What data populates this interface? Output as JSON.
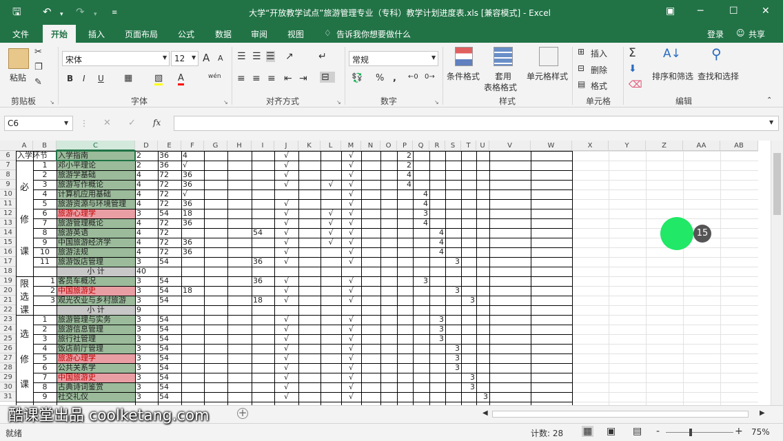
{
  "window": {
    "title": "大学“开放教学试点”旅游管理专业（专科）教学计划进度表.xls  [兼容模式]  -  Excel",
    "login": "登录",
    "share": "共享"
  },
  "icons": {
    "save": "save-icon",
    "undo": "undo-icon",
    "redo": "redo-icon",
    "customize": "customize-quick-access-icon",
    "ribbon_display": "ribbon-display-icon",
    "minimize": "minimize-icon",
    "restore": "restore-icon",
    "close": "close-icon",
    "share": "share-icon",
    "search": "lightbulb-icon"
  },
  "tabs": [
    "文件",
    "开始",
    "插入",
    "页面布局",
    "公式",
    "数据",
    "审阅",
    "视图"
  ],
  "tellme": "告诉我你想要做什么",
  "ribbon": {
    "clipboard": {
      "paste": "粘贴",
      "label": "剪贴板"
    },
    "font": {
      "name": "宋体",
      "size": "12",
      "label": "字体",
      "bold": "B",
      "italic": "I",
      "underline": "U",
      "grow": "A",
      "shrink": "A",
      "font_color": "A",
      "phonetic": "wén"
    },
    "alignment": {
      "label": "对齐方式"
    },
    "number": {
      "format": "常规",
      "label": "数字",
      "percent": "%",
      "comma": ","
    },
    "styles": {
      "conditional": "条件格式",
      "table_a": "套用",
      "table_b": "表格格式",
      "cell_styles": "单元格样式",
      "label": "样式"
    },
    "cells": {
      "insert": "插入",
      "delete": "删除",
      "format": "格式",
      "label": "单元格"
    },
    "editing": {
      "sort": "排序和筛选",
      "find": "查找和选择",
      "label": "编辑"
    }
  },
  "formula": {
    "name_box": "C6",
    "fx": "fx",
    "content": ""
  },
  "columns": [
    "A",
    "B",
    "C",
    "D",
    "E",
    "F",
    "G",
    "H",
    "I",
    "J",
    "K",
    "L",
    "M",
    "N",
    "O",
    "P",
    "Q",
    "R",
    "S",
    "T",
    "U",
    "V",
    "W",
    "X",
    "Y",
    "Z",
    "AA",
    "AB"
  ],
  "rows": [
    "6",
    "7",
    "8",
    "9",
    "10",
    "11",
    "12",
    "13",
    "14",
    "15",
    "16",
    "17",
    "18",
    "19",
    "20",
    "21",
    "22",
    "23",
    "24",
    "25",
    "26",
    "27",
    "28",
    "29",
    "30",
    "31"
  ],
  "colors": {
    "accent": "#217346",
    "course_fill": "#9bbb9b",
    "red_fill": "#e99ea4",
    "subtotal_fill": "#c8c8c8",
    "header_selected": "#d3e9dc"
  },
  "cells": {
    "top_left": "入学环节",
    "cat_required": "必修课",
    "cat_limited": "限选课",
    "cat_elective": "选修课",
    "course_rows": [
      {
        "r": 0,
        "b": "",
        "c": "入学指南",
        "d": "2",
        "e": "36",
        "f": "4",
        "j": "√",
        "m": "√",
        "p": "2"
      },
      {
        "r": 1,
        "b": "1",
        "c": "邓小平理论",
        "d": "2",
        "e": "36",
        "f": "√",
        "j": "√",
        "m": "√",
        "p": "2"
      },
      {
        "r": 2,
        "b": "2",
        "c": "旅游学基础",
        "d": "4",
        "e": "72",
        "f": "36",
        "j": "√",
        "m": "√",
        "p": "4"
      },
      {
        "r": 3,
        "b": "3",
        "c": "旅游写作概论",
        "d": "4",
        "e": "72",
        "f": "36",
        "j": "√",
        "l": "√",
        "m": "√",
        "p": "4"
      },
      {
        "r": 4,
        "b": "4",
        "c": "计算机应用基础",
        "d": "4",
        "e": "72",
        "f": "√",
        "m": "√",
        "q": "4"
      },
      {
        "r": 5,
        "b": "5",
        "c": "旅游资源与环境管理",
        "d": "4",
        "e": "72",
        "f": "36",
        "j": "√",
        "m": "√",
        "q": "4"
      },
      {
        "r": 6,
        "b": "6",
        "c": "旅游心理学",
        "red": true,
        "d": "3",
        "e": "54",
        "f": "18",
        "j": "√",
        "l": "√",
        "m": "√",
        "q": "3"
      },
      {
        "r": 7,
        "b": "7",
        "c": "旅游管理概论",
        "d": "4",
        "e": "72",
        "f": "36",
        "j": "√",
        "l": "√",
        "m": "√",
        "q": "4"
      },
      {
        "r": 8,
        "b": "8",
        "c": "旅游英语",
        "d": "4",
        "e": "72",
        "i": "54",
        "j": "√",
        "l": "√",
        "m": "√",
        "r2": "4"
      },
      {
        "r": 9,
        "b": "9",
        "c": "中国旅游经济学",
        "d": "4",
        "e": "72",
        "f": "36",
        "j": "√",
        "l": "√",
        "m": "√",
        "r2": "4"
      },
      {
        "r": 10,
        "b": "10",
        "c": "旅游法规",
        "d": "4",
        "e": "72",
        "f": "36",
        "j": "√",
        "m": "√",
        "r2": "4"
      },
      {
        "r": 11,
        "b": "11",
        "c": "旅游饭店管理",
        "d": "3",
        "e": "54",
        "i": "36",
        "j": "√",
        "m": "√",
        "s": "3"
      },
      {
        "r": 13,
        "b": "1",
        "c": "客员车概况",
        "d": "3",
        "e": "54",
        "i": "36",
        "j": "√",
        "m": "√",
        "q": "3"
      },
      {
        "r": 14,
        "b": "2",
        "c": "中国旅游史",
        "red": true,
        "d": "3",
        "e": "54",
        "f": "18",
        "j": "√",
        "m": "√",
        "s": "3"
      },
      {
        "r": 15,
        "b": "3",
        "c": "观光农业与乡村旅游",
        "d": "3",
        "e": "54",
        "i": "18",
        "j": "√",
        "m": "√",
        "t": "3"
      },
      {
        "r": 17,
        "b": "1",
        "c": "旅游管理与实务",
        "d": "3",
        "e": "54",
        "j": "√",
        "m": "√",
        "r2": "3"
      },
      {
        "r": 18,
        "b": "2",
        "c": "旅游信息管理",
        "d": "3",
        "e": "54",
        "j": "√",
        "m": "√",
        "r2": "3"
      },
      {
        "r": 19,
        "b": "3",
        "c": "旅行社管理",
        "d": "3",
        "e": "54",
        "j": "√",
        "m": "√",
        "r2": "3"
      },
      {
        "r": 20,
        "b": "4",
        "c": "饭店前厅管理",
        "d": "3",
        "e": "54",
        "j": "√",
        "m": "√",
        "s": "3"
      },
      {
        "r": 21,
        "b": "5",
        "c": "旅游心理学",
        "red": true,
        "d": "3",
        "e": "54",
        "j": "√",
        "m": "√",
        "s": "3"
      },
      {
        "r": 22,
        "b": "6",
        "c": "公共关系学",
        "d": "3",
        "e": "54",
        "j": "√",
        "m": "√",
        "s": "3"
      },
      {
        "r": 23,
        "b": "7",
        "c": "中国旅游史",
        "red": true,
        "d": "3",
        "e": "54",
        "j": "√",
        "m": "√",
        "t": "3"
      },
      {
        "r": 24,
        "b": "8",
        "c": "古典诗词鉴赏",
        "d": "3",
        "e": "54",
        "j": "√",
        "m": "√",
        "t": "3"
      },
      {
        "r": 25,
        "b": "9",
        "c": "社交礼仪",
        "d": "3",
        "e": "54",
        "j": "√",
        "m": "√",
        "u": "3"
      }
    ],
    "subtotals": [
      {
        "r": 12,
        "label": "小 计",
        "d": "40"
      },
      {
        "r": 16,
        "label": "小  计",
        "d": "9"
      }
    ]
  },
  "sheet": {
    "add": "+"
  },
  "status": {
    "ready": "就绪",
    "count": "计数: 28",
    "zoom": "75%",
    "zoom_minus": "-",
    "zoom_plus": "+"
  },
  "watermark": "酷课堂出品 coolketang.com",
  "badge": "15"
}
